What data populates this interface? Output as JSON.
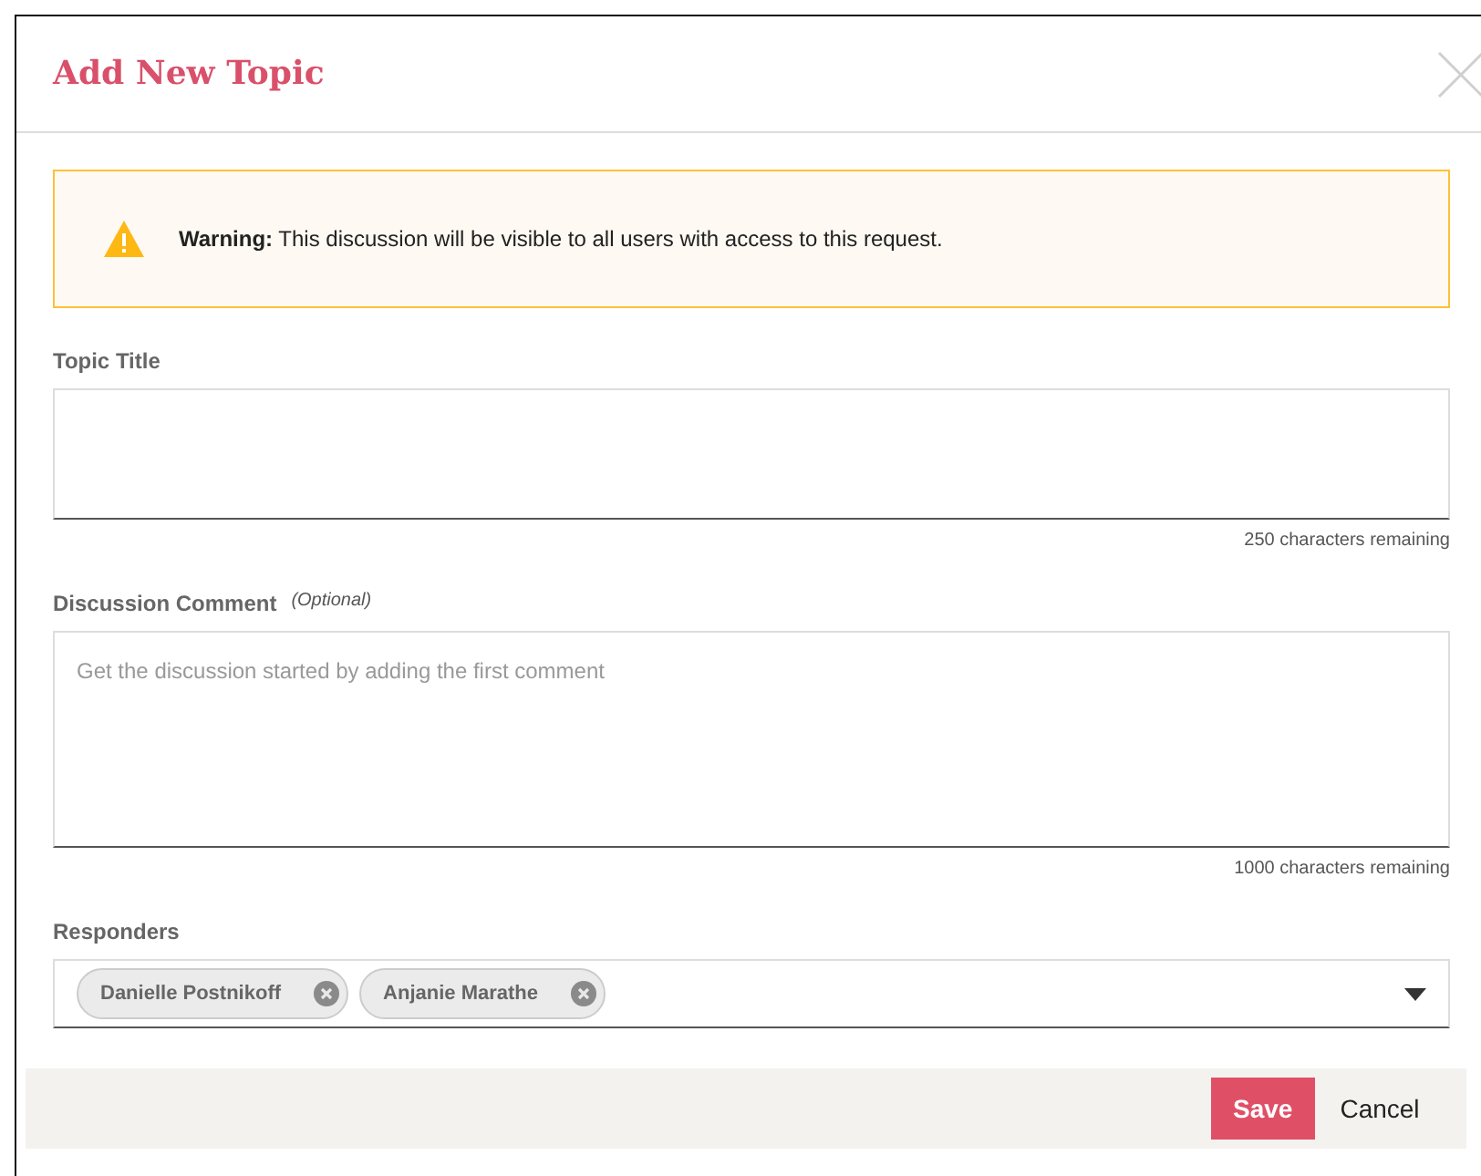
{
  "dialog": {
    "title": "Add New Topic"
  },
  "warning": {
    "text": "**Warning:** This discussion will be visible to all users with access to this request."
  },
  "topic_title": {
    "label": "Topic Title",
    "counter": "250 characters remaining"
  },
  "discussion_comment": {
    "label": "Discussion Comment",
    "hint": "(Optional)",
    "placeholder": "Get the discussion started by adding the first comment",
    "counter": "1000 characters remaining"
  },
  "responders": {
    "label": "Responders",
    "tags": [
      {
        "name": "Danielle Postnikoff"
      },
      {
        "name": "Anjanie Marathe"
      }
    ]
  },
  "buttons": [
    {
      "label": "Save",
      "kind": "primary"
    },
    {
      "label": "Cancel",
      "kind": "link"
    }
  ]
}
